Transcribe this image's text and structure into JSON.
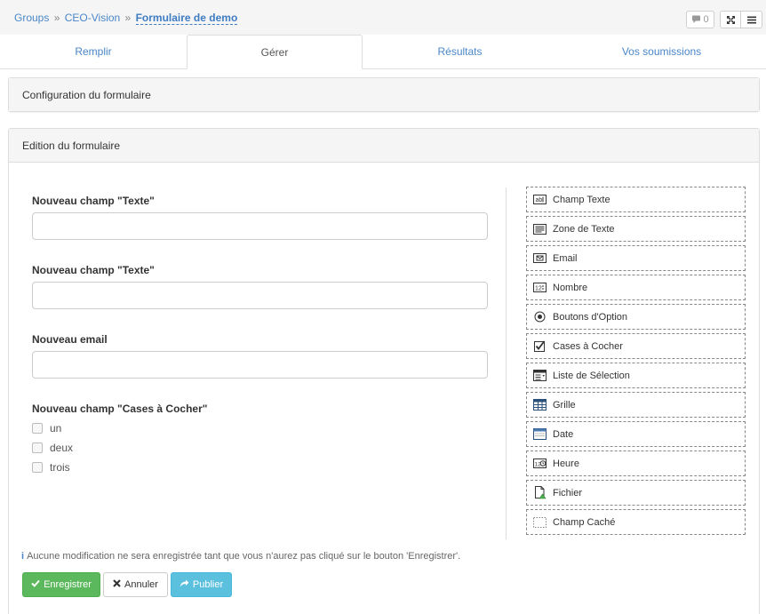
{
  "breadcrumb": {
    "items": [
      "Groups",
      "CEO-Vision"
    ],
    "separator": "»",
    "current": "Formulaire de demo"
  },
  "header_actions": {
    "comments_count": "0",
    "comment_icon": "comment-icon",
    "expand_icon": "expand-icon",
    "menu_icon": "menu-icon"
  },
  "tabs": [
    {
      "label": "Remplir",
      "active": false
    },
    {
      "label": "Gérer",
      "active": true
    },
    {
      "label": "Résultats",
      "active": false
    },
    {
      "label": "Vos soumissions",
      "active": false
    }
  ],
  "panels": {
    "config_title": "Configuration du formulaire",
    "edit_title": "Edition du formulaire"
  },
  "form": {
    "fields": [
      {
        "label": "Nouveau champ \"Texte\"",
        "type": "text",
        "value": ""
      },
      {
        "label": "Nouveau champ \"Texte\"",
        "type": "text",
        "value": ""
      },
      {
        "label": "Nouveau email",
        "type": "email",
        "value": ""
      }
    ],
    "checkbox_group": {
      "label": "Nouveau champ \"Cases à Cocher\"",
      "options": [
        {
          "label": "un",
          "checked": false
        },
        {
          "label": "deux",
          "checked": false
        },
        {
          "label": "trois",
          "checked": false
        }
      ]
    }
  },
  "palette": [
    {
      "label": "Champ Texte",
      "icon": "text-field-icon"
    },
    {
      "label": "Zone de Texte",
      "icon": "textarea-icon"
    },
    {
      "label": "Email",
      "icon": "email-icon"
    },
    {
      "label": "Nombre",
      "icon": "number-icon"
    },
    {
      "label": "Boutons d'Option",
      "icon": "radio-icon"
    },
    {
      "label": "Cases à Cocher",
      "icon": "checkbox-icon"
    },
    {
      "label": "Liste de Sélection",
      "icon": "select-list-icon"
    },
    {
      "label": "Grille",
      "icon": "grid-icon"
    },
    {
      "label": "Date",
      "icon": "calendar-icon"
    },
    {
      "label": "Heure",
      "icon": "clock-icon"
    },
    {
      "label": "Fichier",
      "icon": "file-icon"
    },
    {
      "label": "Champ Caché",
      "icon": "hidden-field-icon"
    }
  ],
  "notice": {
    "icon": "info-icon",
    "text": "Aucune modification ne sera enregistrée tant que vous n'aurez pas cliqué sur le bouton 'Enregistrer'."
  },
  "actions": {
    "save_label": "Enregistrer",
    "cancel_label": "Annuler",
    "publish_label": "Publier"
  },
  "colors": {
    "link": "#4a86c8",
    "save": "#5cb85c",
    "publish": "#5bc0de"
  }
}
